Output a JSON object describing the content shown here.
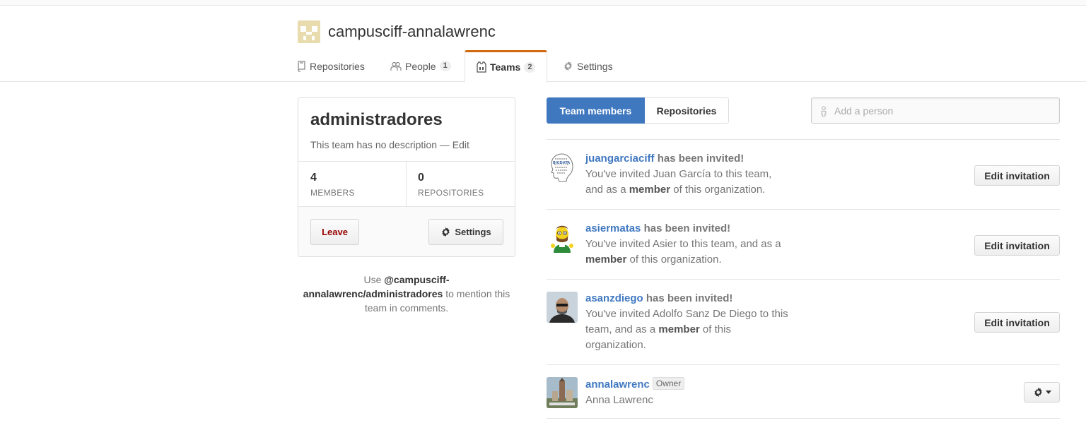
{
  "org": {
    "name": "campusciff-annalawrenc",
    "avatar_color": "#e8dcae"
  },
  "tabs": [
    {
      "label": "Repositories",
      "icon": "repo-icon"
    },
    {
      "label": "People",
      "count": "1",
      "icon": "people-icon"
    },
    {
      "label": "Teams",
      "count": "2",
      "icon": "jersey-icon",
      "selected": true
    },
    {
      "label": "Settings",
      "icon": "gear-icon"
    }
  ],
  "team": {
    "name": "administradores",
    "description": "This team has no description",
    "separator": " — ",
    "edit_label": "Edit",
    "members_count": "4",
    "members_label": "MEMBERS",
    "repos_count": "0",
    "repos_label": "REPOSITORIES",
    "leave_label": "Leave",
    "settings_label": "Settings"
  },
  "mention": {
    "prefix": "Use ",
    "handle": "@campusciff-annalawrenc/administradores",
    "suffix": " to mention this team in comments."
  },
  "segmented": {
    "active_label": "Team members",
    "inactive_label": "Repositories"
  },
  "add_person": {
    "placeholder": "Add a person"
  },
  "members": [
    {
      "login": "juangarciaciff",
      "status": " has been invited!",
      "desc_pre": "You've invited Juan García to this team, and as a ",
      "desc_role": "member",
      "desc_post": " of this organization.",
      "action": "Edit invitation"
    },
    {
      "login": "asiermatas",
      "status": " has been invited!",
      "desc_pre": "You've invited Asier to this team, and as a ",
      "desc_role": "member",
      "desc_post": " of this organization.",
      "action": "Edit invitation"
    },
    {
      "login": "asanzdiego",
      "status": " has been invited!",
      "desc_pre": "You've invited Adolfo Sanz De Diego to this team, and as a ",
      "desc_role": "member",
      "desc_post": " of this organization.",
      "action": "Edit invitation"
    },
    {
      "login": "annalawrenc",
      "badge": "Owner",
      "full_name": "Anna Lawrenc"
    }
  ],
  "colors": {
    "accent": "#4078c0",
    "tab_highlight": "#d26911",
    "danger": "#990000"
  }
}
